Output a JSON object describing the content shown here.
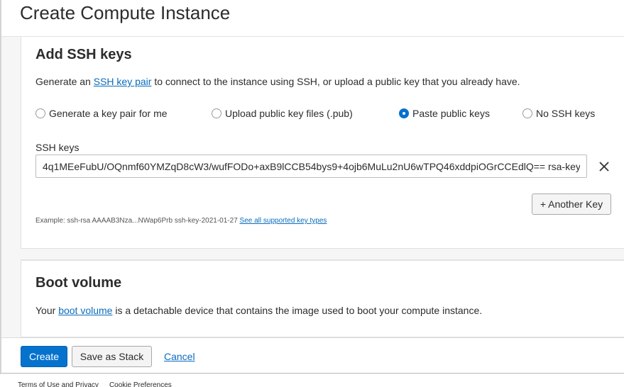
{
  "page": {
    "title": "Create Compute Instance"
  },
  "ssh_section": {
    "title": "Add SSH keys",
    "description_before": "Generate an ",
    "description_link": "SSH key pair",
    "description_after": " to connect to the instance using SSH, or upload a public key that you already have.",
    "options": [
      {
        "label": "Generate a key pair for me",
        "selected": false
      },
      {
        "label": "Upload public key files (.pub)",
        "selected": false
      },
      {
        "label": "Paste public keys",
        "selected": true
      },
      {
        "label": "No SSH keys",
        "selected": false
      }
    ],
    "field_label": "SSH keys",
    "field_value": "4q1MEeFubU/OQnmf60YMZqD8cW3/wufFODo+axB9lCCB54bys9+4ojb6MuLu2nU6wTPQ46xddpiOGrCCEdlQ== rsa-key",
    "another_key_label": "+ Another Key",
    "example_text": "Example: ssh-rsa AAAAB3Nza...NWap6Prb ssh-key-2021-01-27",
    "example_link": "See all supported key types"
  },
  "boot_section": {
    "title": "Boot volume",
    "description_before": "Your ",
    "description_link": "boot volume",
    "description_after": " is a detachable device that contains the image used to boot your compute instance."
  },
  "footer": {
    "create_label": "Create",
    "save_stack_label": "Save as Stack",
    "cancel_label": "Cancel"
  },
  "bottom_links": {
    "terms": "Terms of Use and Privacy",
    "cookies": "Cookie Preferences"
  },
  "colors": {
    "accent": "#0572ce",
    "link": "#0a6cbd"
  },
  "icons": {
    "remove_key": "close-icon"
  }
}
